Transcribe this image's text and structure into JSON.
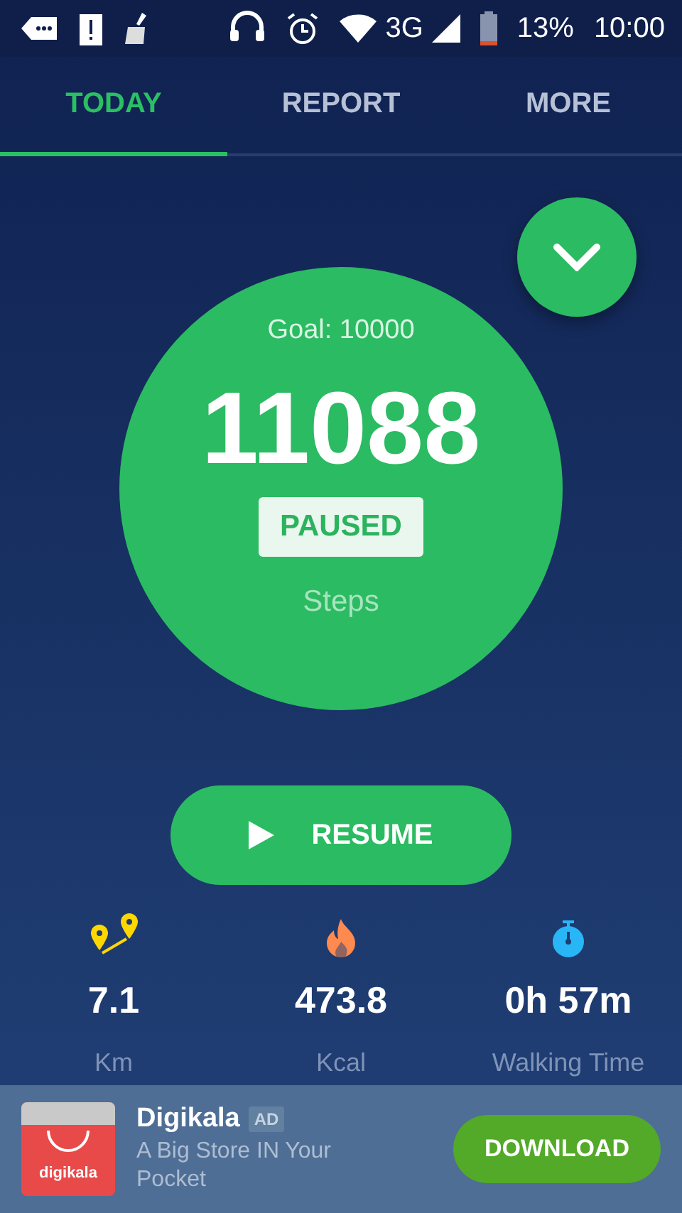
{
  "status_bar": {
    "battery": "13%",
    "time": "10:00",
    "network": "3G"
  },
  "tabs": [
    {
      "label": "TODAY",
      "selected": true
    },
    {
      "label": "REPORT",
      "selected": false
    },
    {
      "label": "MORE",
      "selected": false
    }
  ],
  "counter": {
    "goal": "Goal: 10000",
    "steps": "11088",
    "state": "PAUSED",
    "unit": "Steps"
  },
  "resume_button": {
    "label": "RESUME"
  },
  "stats": [
    {
      "kind": "distance",
      "value": "7.1",
      "label": "Km"
    },
    {
      "kind": "calories",
      "value": "473.8",
      "label": "Kcal"
    },
    {
      "kind": "time",
      "value": "0h 57m",
      "label": "Walking Time"
    }
  ],
  "ad": {
    "icon_label": "digikala",
    "title": "Digikala",
    "badge": "AD",
    "description": "A Big Store IN Your Pocket",
    "button": "DOWNLOAD"
  }
}
